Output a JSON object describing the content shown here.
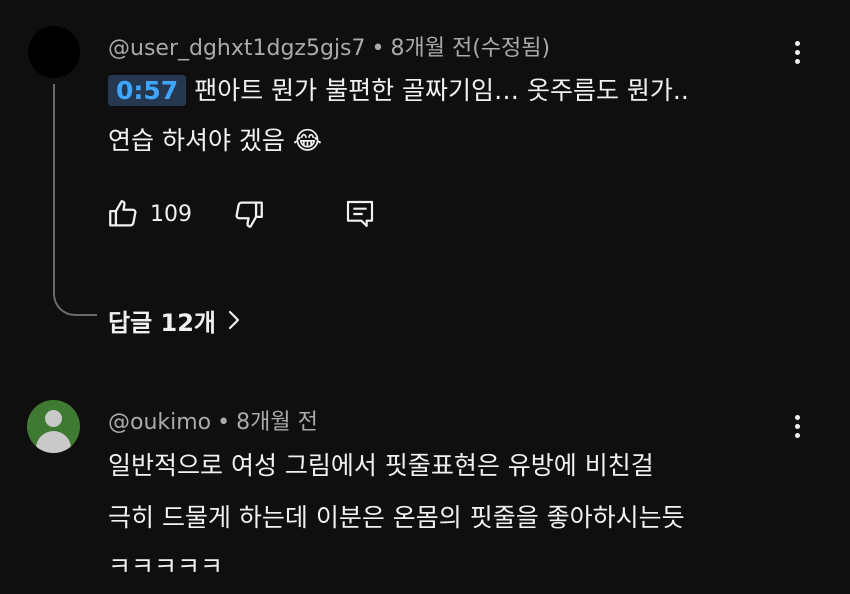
{
  "comment1": {
    "author": "@user_dghxt1dgz5gjs7",
    "separator": "•",
    "time": "8개월 전(수정됨)",
    "timestamp_link": "0:57",
    "line1": "팬아트 뭔가 불편한 골짜기임… 옷주름도 뭔가..",
    "line2": "연습 하셔야 겠음",
    "emoji": "😂",
    "like_count": "109",
    "replies_label": "답글 12개"
  },
  "comment2": {
    "author": "@oukimo",
    "separator": "•",
    "time": "8개월 전",
    "line1": "일반적으로 여성 그림에서 핏줄표현은 유방에 비친걸",
    "line2": "극히 드물게 하는데 이분은 온몸의 핏줄을 좋아하시는듯",
    "line3": "ㅋㅋㅋㅋㅋ"
  },
  "colors": {
    "background": "#0f0f0f",
    "text": "#f1f1f1",
    "meta": "#aaaaaa",
    "link": "#3ea6ff",
    "link_bg": "#263850",
    "avatar_green": "#3e7a31"
  },
  "icons": [
    "more-vert-icon",
    "thumb-up-icon",
    "thumb-down-icon",
    "reply-icon",
    "chevron-right-icon",
    "default-avatar-icon"
  ]
}
